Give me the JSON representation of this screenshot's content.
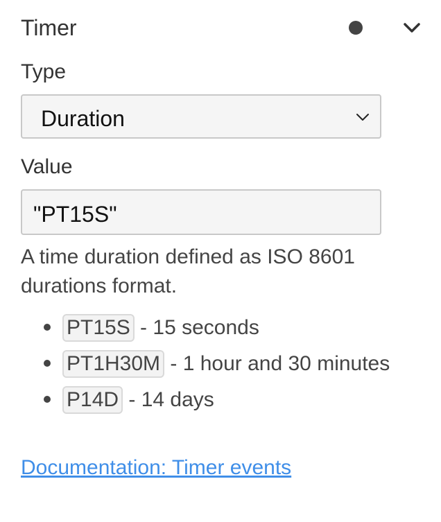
{
  "section": {
    "title": "Timer"
  },
  "type_field": {
    "label": "Type",
    "selected": "Duration"
  },
  "value_field": {
    "label": "Value",
    "value": "\"PT15S\""
  },
  "help": {
    "description": "A time duration defined as ISO 8601 durations format.",
    "examples": [
      {
        "code": "PT15S",
        "text": " - 15 seconds"
      },
      {
        "code": "PT1H30M",
        "text": " - 1 hour and 30 minutes"
      },
      {
        "code": "P14D",
        "text": " - 14 days"
      }
    ],
    "link_text": "Documentation: Timer events"
  },
  "icons": {
    "status": "dot-icon",
    "collapse": "chevron-down-icon",
    "select_arrow": "chevron-down-icon"
  },
  "colors": {
    "link": "#3f8ee8",
    "field_background": "#f5f5f5",
    "field_border": "#c8c8c8"
  }
}
